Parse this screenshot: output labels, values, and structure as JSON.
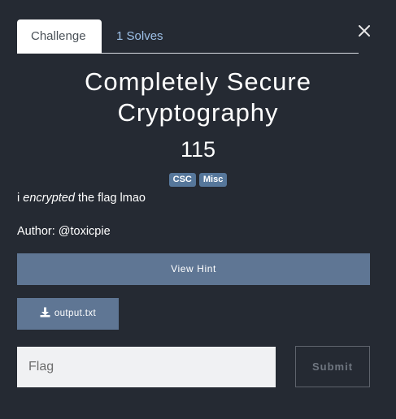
{
  "tabs": [
    {
      "label": "Challenge"
    },
    {
      "label": "1 Solves"
    }
  ],
  "close_icon": "close-icon",
  "challenge": {
    "title_line1": "Completely Secure",
    "title_line2": "Cryptography",
    "value": "115",
    "tags": [
      "CSC",
      "Misc"
    ],
    "description_pre": "i ",
    "description_em": "encrypted",
    "description_post": " the flag lmao",
    "author": "Author: @toxicpie"
  },
  "hint": {
    "label": "View Hint"
  },
  "file": {
    "label": "output.txt",
    "icon": "download-icon"
  },
  "flag_form": {
    "placeholder": "Flag",
    "submit_label": "Submit"
  },
  "colors": {
    "background": "#252a33",
    "accent": "#5f7694",
    "tag": "#56779b",
    "tab_link": "#9ec1e8"
  }
}
